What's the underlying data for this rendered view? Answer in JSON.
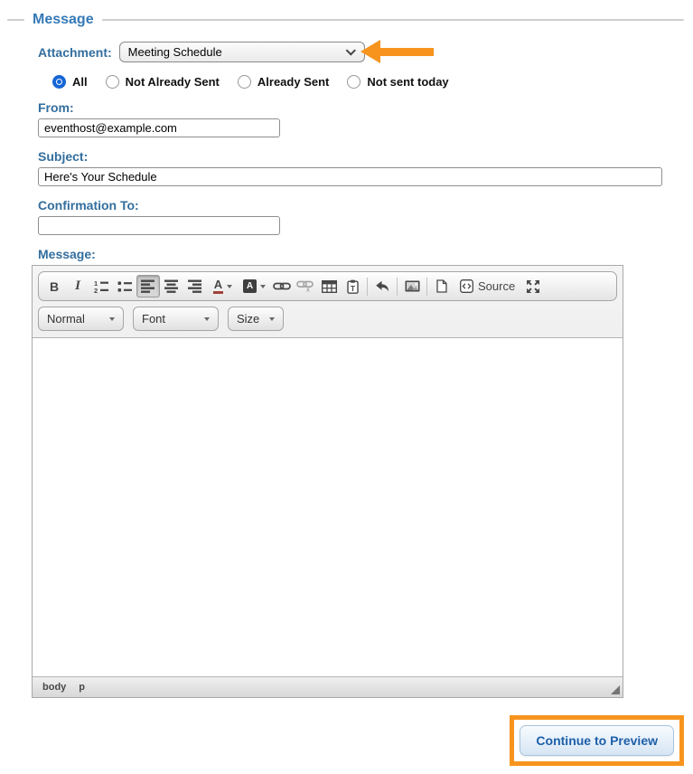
{
  "colors": {
    "label_blue": "#336e9e",
    "header_blue": "#3579b6",
    "annotation_orange": "#f7941e",
    "button_text_blue": "#1d5fa9",
    "selected_radio_blue": "#1566d6"
  },
  "section": {
    "title": "Message"
  },
  "form": {
    "attachment": {
      "label": "Attachment:",
      "value": "Meeting Schedule"
    },
    "recipient_filter": {
      "options": [
        {
          "label": "All",
          "selected": true
        },
        {
          "label": "Not Already Sent",
          "selected": false
        },
        {
          "label": "Already Sent",
          "selected": false
        },
        {
          "label": "Not sent today",
          "selected": false
        }
      ]
    },
    "from": {
      "label": "From:",
      "value": "eventhost@example.com"
    },
    "subject": {
      "label": "Subject:",
      "value": "Here's Your Schedule"
    },
    "confirmation_to": {
      "label": "Confirmation To:",
      "value": ""
    },
    "message": {
      "label": "Message:"
    }
  },
  "editor": {
    "toolbar_icons": [
      "bold",
      "italic",
      "numbered-list",
      "bulleted-list",
      "align-left",
      "align-center",
      "align-right",
      "text-color",
      "background-color",
      "link",
      "unlink",
      "table",
      "paste-from-word",
      "undo",
      "image",
      "new-page",
      "source",
      "maximize"
    ],
    "active_tool": "align-left",
    "source_label": "Source",
    "dropdowns": [
      {
        "name": "paragraph-format",
        "label": "Normal"
      },
      {
        "name": "font-name",
        "label": "Font"
      },
      {
        "name": "font-size",
        "label": "Size"
      }
    ],
    "element_path": [
      "body",
      "p"
    ],
    "content": ""
  },
  "actions": {
    "continue_button_label": "Continue to Preview"
  }
}
